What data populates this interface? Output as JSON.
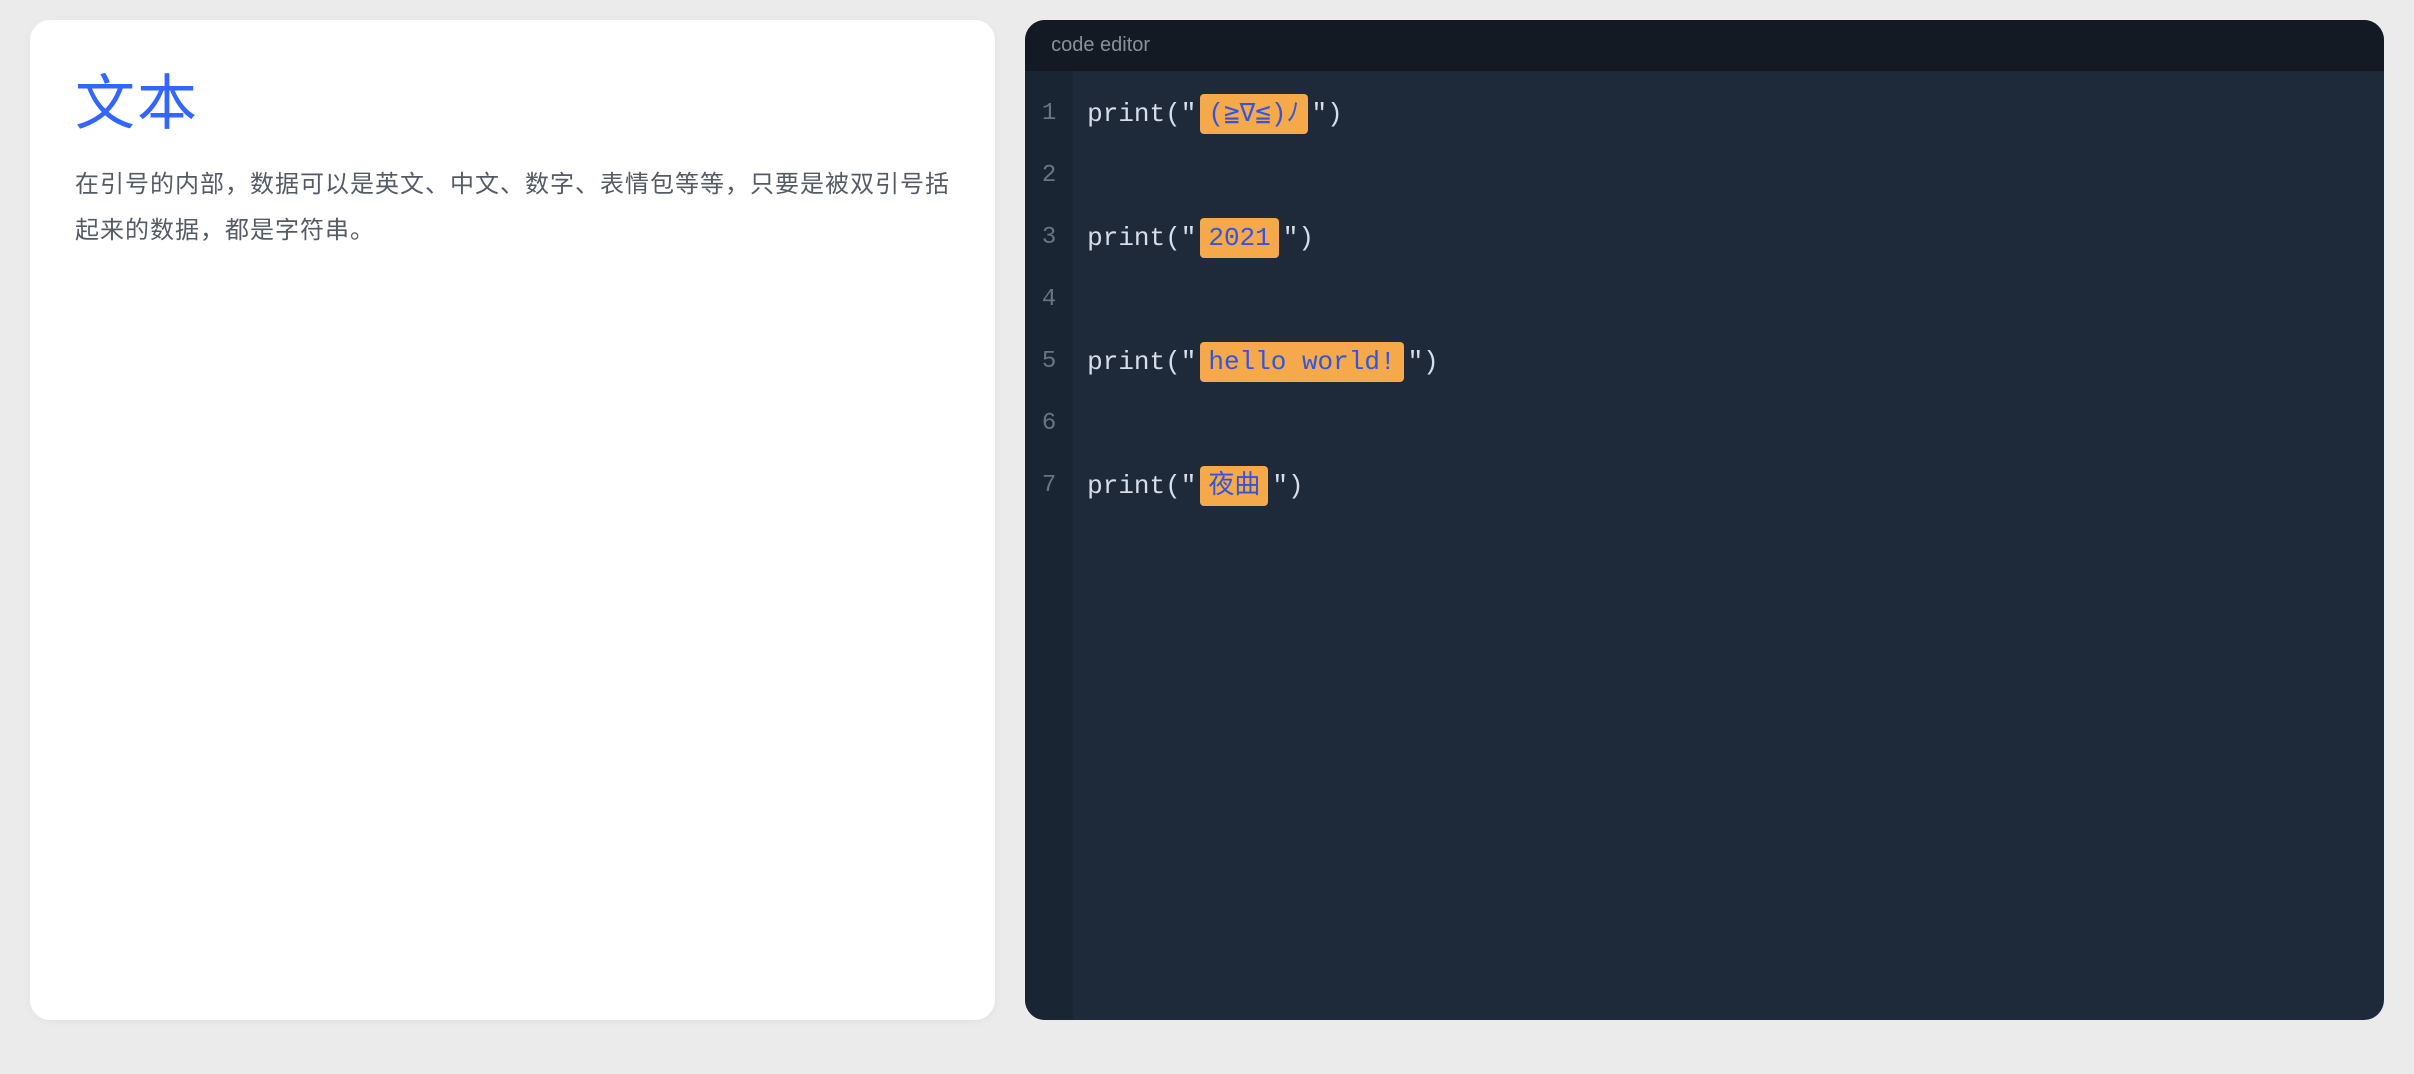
{
  "left": {
    "title": "文本",
    "description": "在引号的内部，数据可以是英文、中文、数字、表情包等等，只要是被双引号括起来的数据，都是字符串。"
  },
  "editor": {
    "header_label": "code editor",
    "lines": [
      {
        "num": "1",
        "type": "print",
        "pre": "print(\"",
        "highlight": "(≧∇≦)ﾉ",
        "post": "\")"
      },
      {
        "num": "2",
        "type": "blank"
      },
      {
        "num": "3",
        "type": "print",
        "pre": "print(\"",
        "highlight": "2021",
        "post": "\")"
      },
      {
        "num": "4",
        "type": "blank"
      },
      {
        "num": "5",
        "type": "print",
        "pre": "print(\"",
        "highlight": "hello world!",
        "post": "\")"
      },
      {
        "num": "6",
        "type": "blank"
      },
      {
        "num": "7",
        "type": "print",
        "pre": "print(\"",
        "highlight": "夜曲",
        "post": "\")"
      }
    ]
  }
}
